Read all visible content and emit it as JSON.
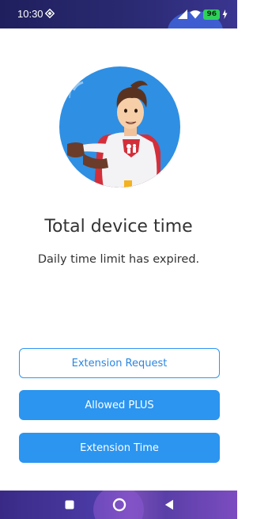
{
  "status_bar": {
    "time": "10:30",
    "battery": "96",
    "left_icon": "vpn-diamond-icon",
    "right_icons": [
      "signal-icon",
      "wifi-icon",
      "battery-icon",
      "charging-bolt-icon"
    ]
  },
  "main": {
    "hero_image": "superhero-mascot",
    "title": "Total device time",
    "subtitle": "Daily time limit has expired."
  },
  "buttons": {
    "extension_request": "Extension Request",
    "allowed_plus": "Allowed PLUS",
    "extension_time": "Extension Time"
  },
  "nav_bar": {
    "icons": [
      "recents-square-icon",
      "home-circle-icon",
      "back-triangle-icon"
    ]
  },
  "colors": {
    "primary": "#2b95f0",
    "outline_text": "#2a86e0",
    "text": "#333333",
    "hero_background": "#2f8fe3",
    "status_bar": "#24246a",
    "nav_bar": "#4a3aa4"
  }
}
